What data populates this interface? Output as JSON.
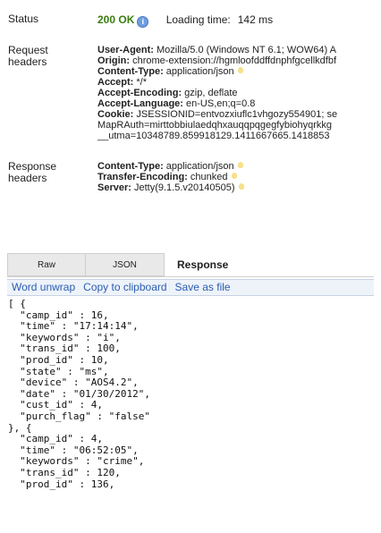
{
  "status": {
    "label": "Status",
    "code": "200 OK",
    "loading_label": "Loading time:",
    "loading_value": "142 ms"
  },
  "request_headers": {
    "label_line1": "Request",
    "label_line2": "headers",
    "lines": [
      {
        "key": "User-Agent:",
        "value": " Mozilla/5.0 (Windows NT 6.1; WOW64) A"
      },
      {
        "key": "Origin:",
        "value": " chrome-extension://hgmloofddffdnphfgcellkdfbf"
      },
      {
        "key": "Content-Type:",
        "value": " application/json",
        "bulb": true
      },
      {
        "key": "Accept:",
        "value": " */*"
      },
      {
        "key": "Accept-Encoding:",
        "value": " gzip, deflate"
      },
      {
        "key": "Accept-Language:",
        "value": " en-US,en;q=0.8"
      },
      {
        "key": "Cookie:",
        "value": " JSESSIONID=entvozxiuflc1vhgozy554901; se"
      },
      {
        "key": "",
        "value": "MapRAuth=mirttobbiulaedqhxauqqpqgegfybiohyqrkkg"
      },
      {
        "key": "",
        "value": "__utma=10348789.859918129.1411667665.1418853"
      }
    ]
  },
  "response_headers": {
    "label_line1": "Response",
    "label_line2": "headers",
    "lines": [
      {
        "key": "Content-Type:",
        "value": " application/json",
        "bulb": true
      },
      {
        "key": "Transfer-Encoding:",
        "value": " chunked",
        "bulb": true
      },
      {
        "key": "Server:",
        "value": " Jetty(9.1.5.v20140505)",
        "bulb": true
      }
    ]
  },
  "tabs": {
    "raw": "Raw",
    "json": "JSON",
    "response": "Response"
  },
  "toolbar": {
    "word_unwrap": "Word unwrap",
    "copy": "Copy to clipboard",
    "save": "Save as file"
  },
  "code_lines": [
    "[ {",
    "  \"camp_id\" : 16,",
    "  \"time\" : \"17:14:14\",",
    "  \"keywords\" : \"i\",",
    "  \"trans_id\" : 100,",
    "  \"prod_id\" : 10,",
    "  \"state\" : \"ms\",",
    "  \"device\" : \"AOS4.2\",",
    "  \"date\" : \"01/30/2012\",",
    "  \"cust_id\" : 4,",
    "  \"purch_flag\" : \"false\"",
    "}, {",
    "  \"camp_id\" : 4,",
    "  \"time\" : \"06:52:05\",",
    "  \"keywords\" : \"crime\",",
    "  \"trans_id\" : 120,",
    "  \"prod_id\" : 136,"
  ]
}
